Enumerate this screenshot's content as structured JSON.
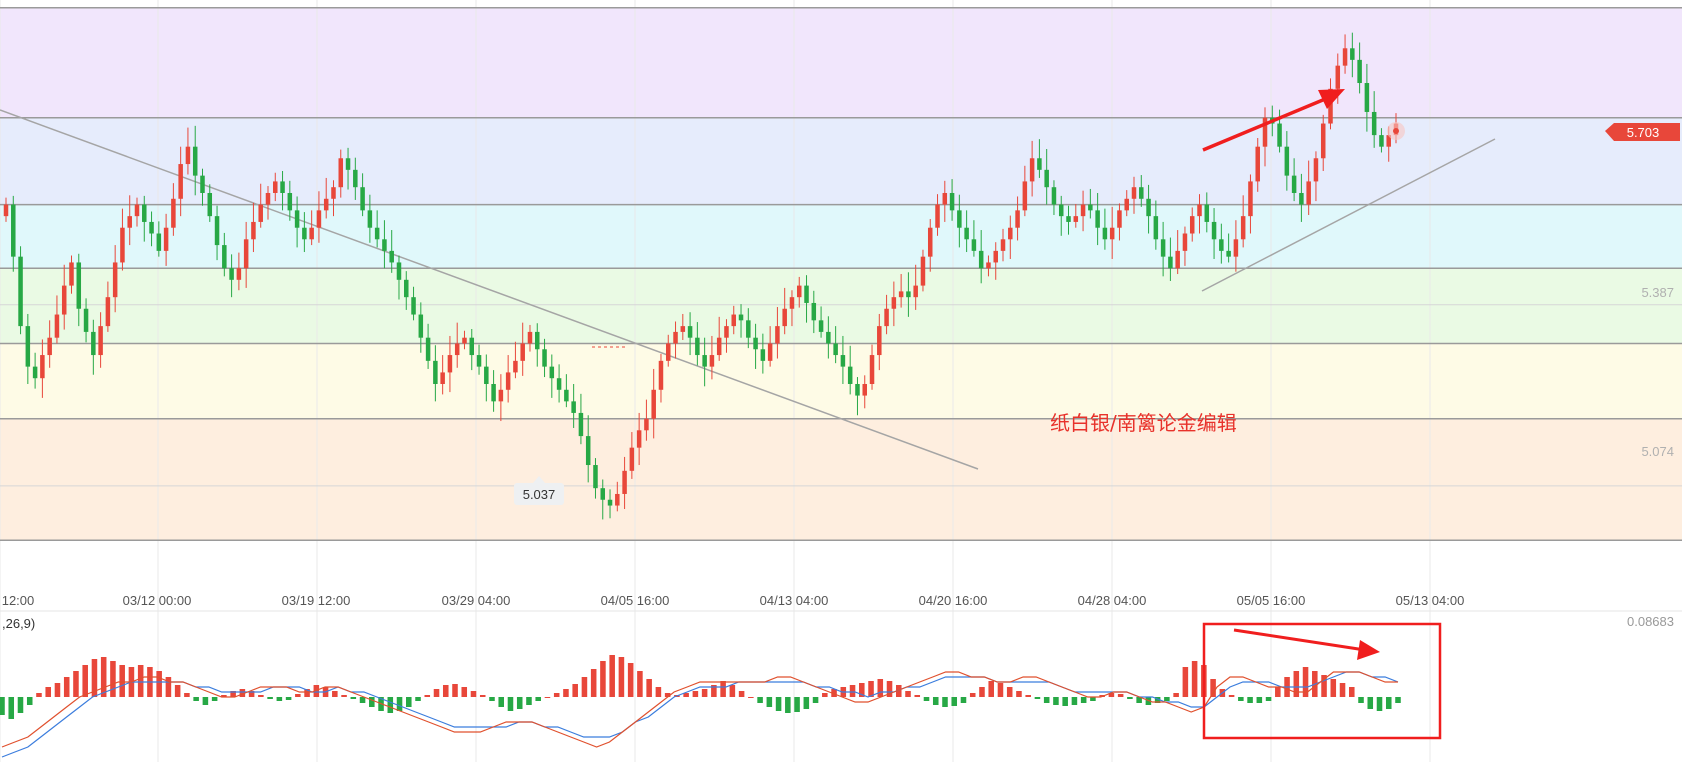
{
  "chart_data": [
    {
      "type": "candlestick",
      "title": "",
      "xlabel": "",
      "ylabel": "",
      "x_tick_labels": [
        "12:00",
        "03/12 00:00",
        "03/19 12:00",
        "03/29 04:00",
        "04/05 16:00",
        "04/13 04:00",
        "04/20 16:00",
        "04/28 04:00",
        "05/05 16:00",
        "05/13 04:00"
      ],
      "ylim": [
        4.95,
        5.98
      ],
      "current_price": "5.703",
      "labeled_levels": [
        {
          "label": "5.387",
          "value": 5.387
        },
        {
          "label": "5.074",
          "value": 5.074
        }
      ],
      "fib_levels": [
        5.9,
        5.71,
        5.56,
        5.45,
        5.32,
        5.19,
        4.98
      ],
      "zone_colors": [
        "#f1e6fc",
        "#e6ecfc",
        "#e0f8fb",
        "#eafae4",
        "#fefbe6",
        "#feeedf"
      ],
      "low_marker": "5.037",
      "candle_up_color": "#e8473a",
      "candle_down_color": "#27a845",
      "series_close": [
        5.56,
        5.47,
        5.35,
        5.28,
        5.26,
        5.3,
        5.33,
        5.37,
        5.42,
        5.46,
        5.38,
        5.34,
        5.3,
        5.35,
        5.4,
        5.46,
        5.52,
        5.54,
        5.56,
        5.53,
        5.51,
        5.48,
        5.52,
        5.57,
        5.63,
        5.66,
        5.61,
        5.58,
        5.54,
        5.49,
        5.45,
        5.43,
        5.45,
        5.5,
        5.53,
        5.56,
        5.58,
        5.6,
        5.58,
        5.55,
        5.52,
        5.5,
        5.52,
        5.55,
        5.57,
        5.59,
        5.64,
        5.62,
        5.59,
        5.55,
        5.52,
        5.5,
        5.48,
        5.46,
        5.43,
        5.4,
        5.37,
        5.33,
        5.29,
        5.25,
        5.27,
        5.3,
        5.32,
        5.33,
        5.3,
        5.28,
        5.25,
        5.22,
        5.24,
        5.27,
        5.29,
        5.32,
        5.34,
        5.31,
        5.28,
        5.26,
        5.24,
        5.22,
        5.2,
        5.16,
        5.11,
        5.07,
        5.05,
        5.04,
        5.06,
        5.1,
        5.14,
        5.17,
        5.19,
        5.24,
        5.29,
        5.32,
        5.34,
        5.35,
        5.33,
        5.3,
        5.28,
        5.3,
        5.33,
        5.35,
        5.37,
        5.36,
        5.33,
        5.31,
        5.29,
        5.32,
        5.35,
        5.38,
        5.4,
        5.42,
        5.39,
        5.36,
        5.34,
        5.32,
        5.3,
        5.28,
        5.25,
        5.23,
        5.25,
        5.3,
        5.35,
        5.38,
        5.4,
        5.41,
        5.4,
        5.42,
        5.47,
        5.52,
        5.56,
        5.58,
        5.55,
        5.52,
        5.5,
        5.48,
        5.45,
        5.46,
        5.48,
        5.5,
        5.52,
        5.55,
        5.6,
        5.64,
        5.62,
        5.59,
        5.56,
        5.54,
        5.53,
        5.54,
        5.56,
        5.55,
        5.52,
        5.5,
        5.52,
        5.55,
        5.57,
        5.59,
        5.57,
        5.54,
        5.5,
        5.47,
        5.45,
        5.48,
        5.51,
        5.54,
        5.56,
        5.53,
        5.5,
        5.48,
        5.47,
        5.5,
        5.54,
        5.6,
        5.66,
        5.71,
        5.7,
        5.66,
        5.61,
        5.58,
        5.56,
        5.6,
        5.64,
        5.7,
        5.76,
        5.8,
        5.83,
        5.81,
        5.77,
        5.72,
        5.68,
        5.66,
        5.68,
        5.7
      ],
      "macd": {
        "label": ",26,9)",
        "max_label": "0.08683",
        "histogram": [
          -0.018,
          -0.022,
          -0.016,
          -0.008,
          0.004,
          0.01,
          0.014,
          0.02,
          0.026,
          0.032,
          0.038,
          0.04,
          0.036,
          0.032,
          0.03,
          0.032,
          0.03,
          0.026,
          0.02,
          0.012,
          0.004,
          -0.004,
          -0.008,
          -0.004,
          0.002,
          0.006,
          0.008,
          0.006,
          0.002,
          -0.002,
          -0.004,
          -0.003,
          0.003,
          0.008,
          0.012,
          0.01,
          0.006,
          0.002,
          -0.002,
          -0.006,
          -0.01,
          -0.014,
          -0.016,
          -0.014,
          -0.01,
          -0.004,
          0.002,
          0.008,
          0.012,
          0.013,
          0.01,
          0.006,
          0.002,
          -0.004,
          -0.01,
          -0.014,
          -0.012,
          -0.008,
          -0.004,
          0.0,
          0.004,
          0.008,
          0.013,
          0.02,
          0.028,
          0.036,
          0.042,
          0.04,
          0.034,
          0.026,
          0.018,
          0.01,
          0.004,
          0.002,
          0.004,
          0.006,
          0.008,
          0.012,
          0.016,
          0.012,
          0.006,
          0.0,
          -0.006,
          -0.01,
          -0.014,
          -0.016,
          -0.015,
          -0.012,
          -0.006,
          0.004,
          0.008,
          0.01,
          0.012,
          0.014,
          0.016,
          0.018,
          0.016,
          0.012,
          0.006,
          0.002,
          -0.004,
          -0.008,
          -0.01,
          -0.009,
          -0.006,
          0.004,
          0.01,
          0.016,
          0.014,
          0.01,
          0.006,
          0.002,
          -0.002,
          -0.006,
          -0.008,
          -0.009,
          -0.008,
          -0.006,
          -0.004,
          0.002,
          0.004,
          0.003,
          -0.002,
          -0.006,
          -0.008,
          -0.006,
          -0.004,
          0.004,
          0.03,
          0.036,
          0.032,
          0.018,
          0.008,
          0.002,
          -0.004,
          -0.006,
          -0.006,
          -0.004,
          0.01,
          0.02,
          0.026,
          0.03,
          0.026,
          0.022,
          0.018,
          0.014,
          0.01,
          -0.006,
          -0.012,
          -0.014,
          -0.012,
          -0.006
        ],
        "dif": [
          -0.1,
          -0.09,
          -0.08,
          -0.06,
          -0.04,
          -0.02,
          0.0,
          0.01,
          0.02,
          0.03,
          0.03,
          0.04,
          0.04,
          0.03,
          0.03,
          0.02,
          0.01,
          0.0,
          0.0,
          0.01,
          0.02,
          0.02,
          0.02,
          0.01,
          0.01,
          0.02,
          0.02,
          0.01,
          0.0,
          -0.01,
          -0.02,
          -0.03,
          -0.04,
          -0.05,
          -0.06,
          -0.07,
          -0.07,
          -0.07,
          -0.06,
          -0.05,
          -0.05,
          -0.05,
          -0.06,
          -0.07,
          -0.08,
          -0.09,
          -0.1,
          -0.09,
          -0.07,
          -0.05,
          -0.03,
          -0.01,
          0.01,
          0.02,
          0.03,
          0.03,
          0.03,
          0.03,
          0.03,
          0.03,
          0.04,
          0.04,
          0.03,
          0.02,
          0.01,
          0.0,
          -0.01,
          -0.01,
          0.0,
          0.01,
          0.02,
          0.03,
          0.04,
          0.05,
          0.05,
          0.04,
          0.04,
          0.03,
          0.03,
          0.04,
          0.04,
          0.03,
          0.02,
          0.01,
          0.0,
          0.0,
          0.01,
          0.01,
          0.0,
          -0.01,
          -0.01,
          -0.02,
          -0.03,
          -0.02,
          0.02,
          0.04,
          0.04,
          0.03,
          0.02,
          0.02,
          0.01,
          0.01,
          0.03,
          0.05,
          0.05,
          0.05,
          0.04,
          0.03,
          0.03
        ],
        "dea": [
          -0.12,
          -0.11,
          -0.1,
          -0.08,
          -0.06,
          -0.04,
          -0.02,
          0.0,
          0.01,
          0.02,
          0.03,
          0.03,
          0.03,
          0.03,
          0.03,
          0.02,
          0.02,
          0.01,
          0.01,
          0.01,
          0.01,
          0.02,
          0.02,
          0.02,
          0.01,
          0.01,
          0.02,
          0.01,
          0.01,
          0.0,
          -0.01,
          -0.02,
          -0.03,
          -0.04,
          -0.05,
          -0.06,
          -0.06,
          -0.06,
          -0.06,
          -0.06,
          -0.05,
          -0.05,
          -0.06,
          -0.06,
          -0.07,
          -0.08,
          -0.08,
          -0.08,
          -0.07,
          -0.05,
          -0.04,
          -0.02,
          0.0,
          0.01,
          0.02,
          0.02,
          0.02,
          0.03,
          0.03,
          0.03,
          0.03,
          0.03,
          0.03,
          0.02,
          0.02,
          0.01,
          0.01,
          0.0,
          0.01,
          0.01,
          0.02,
          0.02,
          0.03,
          0.04,
          0.04,
          0.04,
          0.04,
          0.03,
          0.03,
          0.03,
          0.03,
          0.03,
          0.02,
          0.01,
          0.01,
          0.01,
          0.01,
          0.01,
          0.0,
          0.0,
          -0.01,
          -0.01,
          -0.02,
          -0.02,
          0.0,
          0.02,
          0.03,
          0.03,
          0.03,
          0.02,
          0.02,
          0.02,
          0.03,
          0.04,
          0.05,
          0.05,
          0.04,
          0.04,
          0.03
        ]
      }
    }
  ],
  "annotations": {
    "watermark": "纸白银/南篱论金编辑",
    "arrow_color": "#f01e1e"
  }
}
